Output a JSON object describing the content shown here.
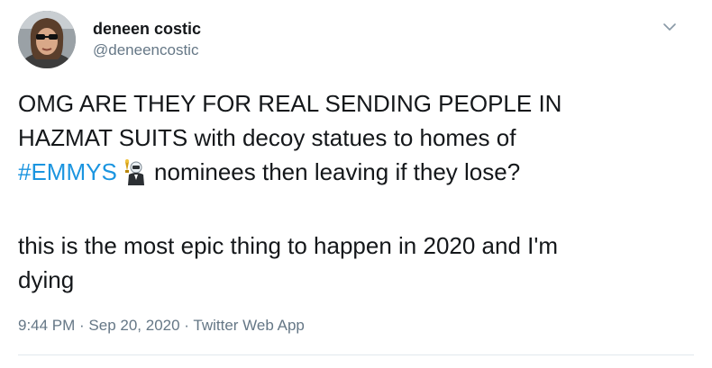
{
  "author": {
    "display_name": "deneen costic",
    "handle": "@deneencostic"
  },
  "icons": {
    "avatar": "avatar-photo",
    "menu": "chevron-down-icon",
    "emmy": "emmy-trophy-hazmat-emoji"
  },
  "tweet": {
    "line1": "OMG ARE THEY FOR REAL SENDING PEOPLE IN",
    "line2": "HAZMAT SUITS with decoy statues to homes of",
    "hashtag": "#EMMYS",
    "line3_rest": " nominees then leaving if they lose?",
    "paragraph2_line1": "this is the most epic thing to happen in 2020 and I'm",
    "paragraph2_line2": "dying"
  },
  "meta": {
    "time": "9:44 PM",
    "sep1": " · ",
    "date": "Sep 20, 2020",
    "sep2": " · ",
    "source": "Twitter Web App"
  },
  "colors": {
    "link": "#1b95e0",
    "secondary_text": "#657786",
    "primary_text": "#14171a",
    "divider": "#e1e8ed"
  }
}
